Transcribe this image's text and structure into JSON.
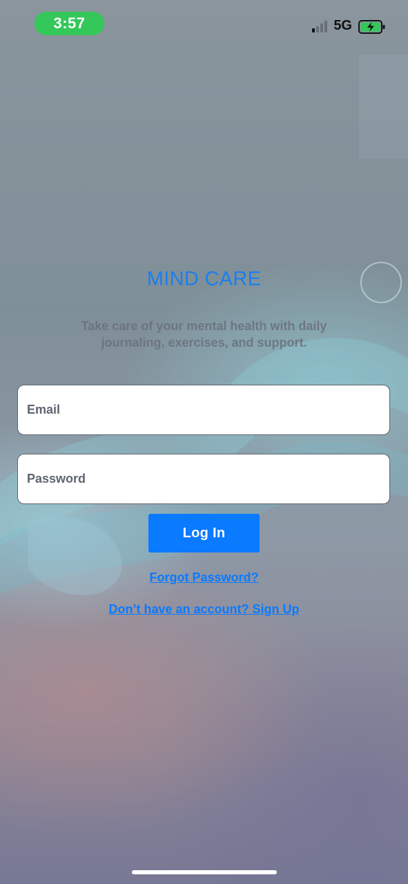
{
  "status_bar": {
    "time": "3:57",
    "network": "5G",
    "icons": [
      "cellular-signal-icon",
      "battery-charging-icon"
    ]
  },
  "app": {
    "title": "MIND CARE",
    "tagline": "Take care of your mental health with daily journaling, exercises, and support."
  },
  "form": {
    "email_placeholder": "Email",
    "password_placeholder": "Password",
    "login_label": "Log In",
    "forgot_label": "Forgot Password?",
    "signup_label": "Don’t have an account? Sign Up"
  },
  "colors": {
    "accent": "#0a7aff",
    "time_pill": "#34c759",
    "battery_fill": "#34c759"
  }
}
